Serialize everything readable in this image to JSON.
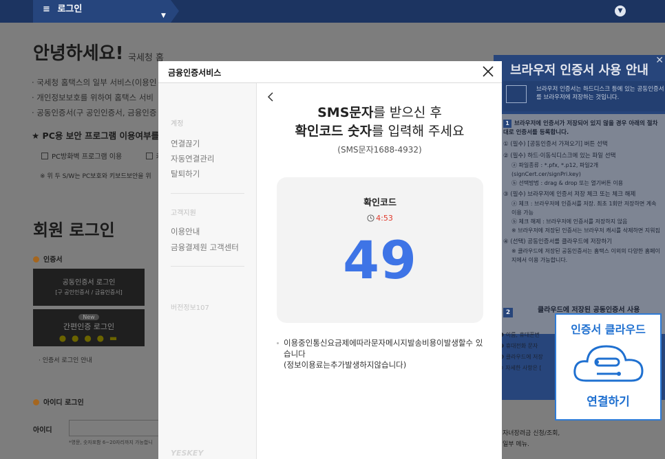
{
  "topbar": {
    "login_label": "로그인",
    "menu_icon": "hamburger-icon"
  },
  "background_page": {
    "greeting": "안녕하세요!",
    "greeting_sub": "국세청 홈",
    "bullets": [
      "· 국세청 홈택스의 일부 서비스(이용인",
      "· 개인정보보호를 위하여 홈택스 서비",
      "· 공동인증서(구 공인인증서, 금융인증"
    ],
    "pc_security_title": "★ PC용 보안 프로그램 이용여부를",
    "pc_firewall": "PC방화벽 프로그램 이용",
    "pc_keyboard": "키",
    "pc_note": "※ 위 두 S/W는 PC보호와 키보드보안을 위",
    "member_login_title": "회원 로그인",
    "cert_section": "인증서",
    "cert_login": "공동인증서 로그인",
    "cert_login_sub": "[구 공인인증서 / 금융인증서]",
    "easy_new": "New",
    "easy_login": "간편인증 로그인",
    "cert_guide": "· 인증서 로그인 안내",
    "id_login_section": "아이디 로그인",
    "id_label": "아이디",
    "id_hint": "*영문, 숫자포함 6~20자리까지 가능합니",
    "right_tail": [
      "자녀장려금 신청/조회,",
      "일부 메뉴."
    ]
  },
  "guide_panel": {
    "title": "브라우저 인증서 사용 안내",
    "intro": "브라우저 인증서는 하드디스크 등에 있는 공동인증서를 브라우저에 저장하는 것입니다.",
    "step1": "브라우저에 인증서가 저장되어 있지 않을 경우 아래의 절차대로 인증서를 등록합니다.",
    "items": [
      "① (필수) [공동인증서 가져오기] 버튼 선택",
      "② (필수) 하드·이동식디스크에 있는 파일 선택",
      "ⓐ 파일종류 : *.pfx, *.p12, 파일2개 (signCert.cer/signPri.key)",
      "ⓑ 선택방법 : drag & drop 또는 열기버튼 이용",
      "③ (필수) 브라우저에 인증서 저장 체크 또는 체크 해제",
      "ⓐ 체크 : 브라우저에 인증서를 저장. 최초 1회만 저장하면 계속 이용 가능",
      "ⓑ 체크 해제 : 브라우저에 인증서를 저장하지 않음",
      "※ 브라우저에 저장된 인증서는 브라우저 캐시를 삭제하면 지워짐",
      "④ (선택) 공동인증서를 클라우드에 저장하기",
      "※ 클라우드에 저장된 공동인증서는 홈택스 이외의 다양한 홈페이지에서 이용 가능합니다."
    ],
    "cloud_row": "클라우드에 저장된 공동인증서 사용",
    "lower": [
      "❶ 이름, 휴대폰번",
      "❷ 휴대전화 문자",
      "❸ 클라우드에 저장",
      "※ 자세한 사항은 ["
    ]
  },
  "cloud_promo": {
    "title": "인증서 클라우드",
    "link": "연결하기",
    "accent": "#1f70d0"
  },
  "modal": {
    "title": "금융인증서비스",
    "sidebar": {
      "section_account": "계정",
      "disconnect": "연결끊기",
      "auto_connect": "자동연결관리",
      "withdraw": "탈퇴하기",
      "section_support": "고객지원",
      "usage_guide": "이용안내",
      "customer_center": "금융결제원 고객센터",
      "version": "버전정보107",
      "brand": "YESKEY"
    },
    "headline_line1_bold": "SMS문자",
    "headline_line1_rest": "를 받으신 후",
    "headline_line2_bold": "확인코드 숫자",
    "headline_line2_rest": "를 입력해 주세요",
    "sms_number": "(SMS문자1688-4932)",
    "code_label": "확인코드",
    "timer": "4:53",
    "code": "49",
    "notice_line1": "이용중인통신요금제에따라문자메시지발송비용이발생할수 있습니다",
    "notice_line2": "(정보이용료는추가발생하지않습니다)"
  },
  "colors": {
    "code_blue": "#3e74e6",
    "timer_red": "#e0392b",
    "topbar": "#1c3461"
  }
}
